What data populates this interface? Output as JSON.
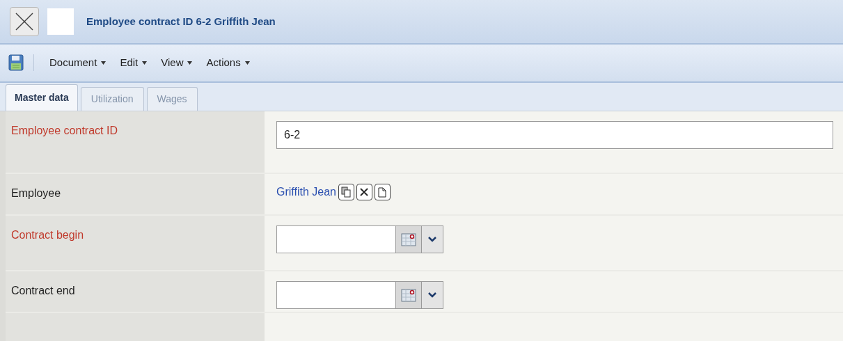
{
  "window": {
    "title": "Employee contract ID 6-2 Griffith Jean"
  },
  "menu": [
    "Document",
    "Edit",
    "View",
    "Actions"
  ],
  "tabs": [
    {
      "label": "Master data",
      "selected": true
    },
    {
      "label": "Utilization",
      "selected": false
    },
    {
      "label": "Wages",
      "selected": false
    }
  ],
  "fields": [
    {
      "label": "Employee contract ID",
      "required": true,
      "kind": "text",
      "value": "6-2"
    },
    {
      "label": "Employee",
      "required": false,
      "kind": "link",
      "value": "Griffith Jean"
    },
    {
      "label": "Contract begin",
      "required": true,
      "kind": "date"
    },
    {
      "label": "Contract end",
      "required": false,
      "kind": "date"
    }
  ]
}
